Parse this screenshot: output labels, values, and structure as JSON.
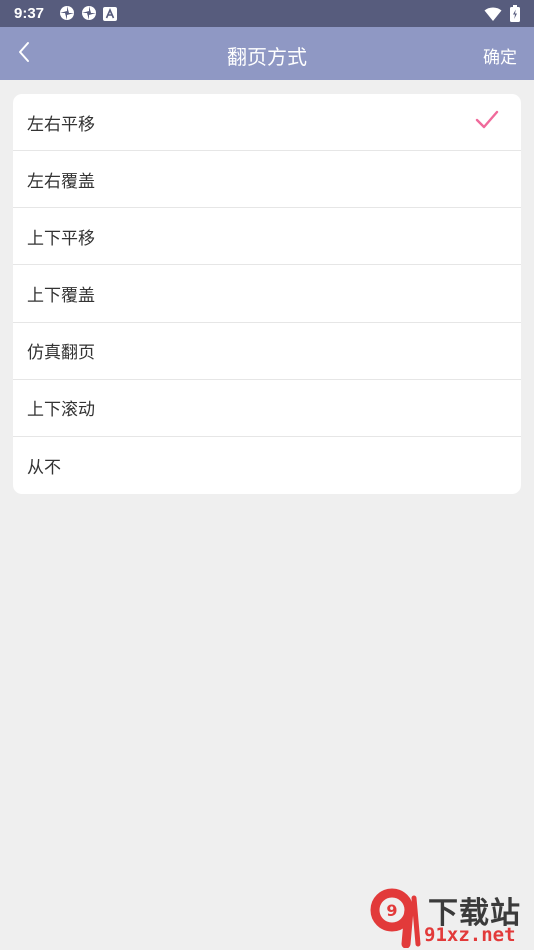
{
  "status_bar": {
    "time": "9:37",
    "left_icons": [
      "pinwheel-icon",
      "pinwheel-icon",
      "font-a-icon"
    ],
    "right_icons": [
      "wifi-icon",
      "battery-icon"
    ]
  },
  "app_bar": {
    "title": "翻页方式",
    "back_icon": "chevron-left-icon",
    "confirm_label": "确定",
    "background": "#8f98c4"
  },
  "options": [
    {
      "label": "左右平移",
      "selected": true
    },
    {
      "label": "左右覆盖",
      "selected": false
    },
    {
      "label": "上下平移",
      "selected": false
    },
    {
      "label": "上下覆盖",
      "selected": false
    },
    {
      "label": "仿真翻页",
      "selected": false
    },
    {
      "label": "上下滚动",
      "selected": false
    },
    {
      "label": "从不",
      "selected": false
    }
  ],
  "check_color": "#f06a9b",
  "watermark": {
    "logo_text": "9",
    "title": "下载站",
    "domain": "91xz.net"
  }
}
